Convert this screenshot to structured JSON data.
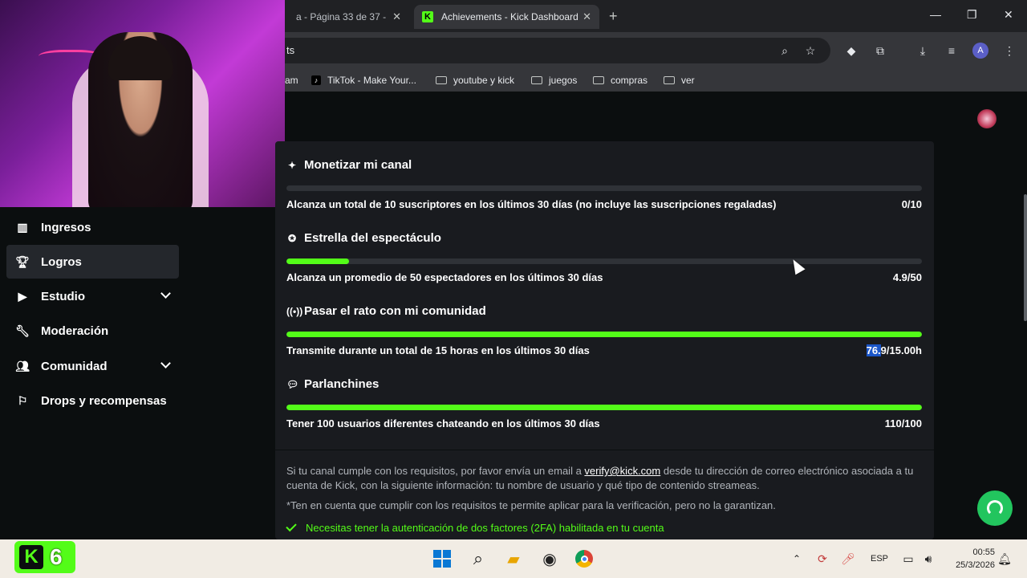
{
  "browser": {
    "tabs": [
      {
        "label": "a - Página 33 de 37 - G",
        "active": false
      },
      {
        "label": "Achievements - Kick Dashboard",
        "active": true
      }
    ],
    "url_fragment": "ts",
    "bookmarks": [
      {
        "label": "am",
        "type": "text"
      },
      {
        "label": "TikTok - Make Your...",
        "type": "tiktok"
      },
      {
        "label": "youtube y kick",
        "type": "folder"
      },
      {
        "label": "juegos",
        "type": "folder"
      },
      {
        "label": "compras",
        "type": "folder"
      },
      {
        "label": "ver",
        "type": "folder"
      }
    ],
    "profile_initial": "A"
  },
  "sidebar": {
    "items": [
      {
        "label": "Ingresos",
        "icon": "bar-chart-icon"
      },
      {
        "label": "Logros",
        "icon": "trophy-icon",
        "active": true
      },
      {
        "label": "Estudio",
        "icon": "video-icon",
        "expandable": true
      },
      {
        "label": "Moderación",
        "icon": "wrench-icon"
      },
      {
        "label": "Comunidad",
        "icon": "users-icon",
        "expandable": true
      },
      {
        "label": "Drops y recompensas",
        "icon": "gift-icon"
      }
    ]
  },
  "achievements": [
    {
      "title": "Monetizar mi canal",
      "icon": "sparkle-icon",
      "description": "Alcanza un total de 10 suscriptores en los últimos 30 días (no incluye las suscripciones regaladas)",
      "value": "0/10",
      "progress": 0.0
    },
    {
      "title": "Estrella del espectáculo",
      "icon": "star-user-icon",
      "description": "Alcanza un promedio de 50 espectadores en los últimos 30 días",
      "value": "4.9/50",
      "progress": 0.098
    },
    {
      "title": "Pasar el rato con mi comunidad",
      "icon": "broadcast-icon",
      "description": "Transmite durante un total de 15 horas en los últimos 30 días",
      "value_highlight": "76.",
      "value_rest": "9/15.00h",
      "progress": 1.0
    },
    {
      "title": "Parlanchines",
      "icon": "chat-icon",
      "description": "Tener 100 usuarios diferentes chateando en los últimos 30 días",
      "value": "110/100",
      "progress": 1.0
    }
  ],
  "info": {
    "line1_pre": "Si tu canal cumple con los requisitos, por favor envía un email a ",
    "email": "verify@kick.com",
    "line1_post": " desde tu dirección de correo electrónico asociada a tu cuenta de Kick, con la siguiente información: tu nombre de usuario y qué tipo de contenido streameas.",
    "note": "*Ten en cuenta que cumplir con los requisitos te permite aplicar para la verificación, pero no la garantizan.",
    "requirement": "Necesitas tener la autenticación de dos factores (2FA) habilitada en tu cuenta"
  },
  "overlay": {
    "kick_count": "6"
  },
  "taskbar": {
    "language": "ESP",
    "time": "00:55",
    "date": "25/3/2026"
  },
  "colors": {
    "accent": "#53fc18",
    "panel": "#191b1f",
    "background": "#0b0e0f"
  }
}
